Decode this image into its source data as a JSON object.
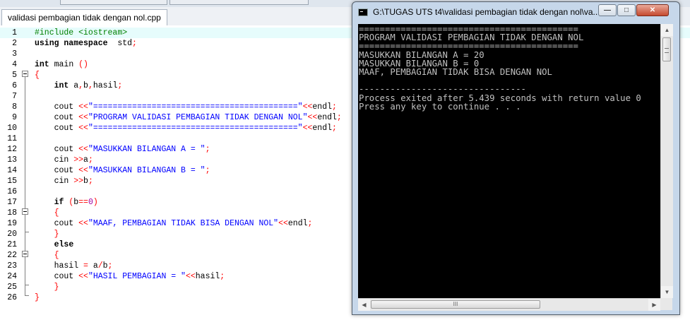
{
  "editor": {
    "tab_label": "validasi pembagian tidak dengan nol.cpp",
    "lines": [
      {
        "n": "1",
        "hl": true,
        "tokens": [
          [
            "pp",
            "#include <iostream>"
          ]
        ]
      },
      {
        "n": "2",
        "tokens": [
          [
            "kw",
            "using namespace"
          ],
          [
            "",
            "  std"
          ],
          [
            "sym",
            ";"
          ]
        ]
      },
      {
        "n": "3",
        "tokens": []
      },
      {
        "n": "4",
        "tokens": [
          [
            "kw",
            "int"
          ],
          [
            "",
            " main "
          ],
          [
            "sym",
            "()"
          ]
        ]
      },
      {
        "n": "5",
        "tokens": [
          [
            "sym",
            "{"
          ]
        ]
      },
      {
        "n": "6",
        "tokens": [
          [
            "",
            "    "
          ],
          [
            "kw",
            "int"
          ],
          [
            "",
            " a"
          ],
          [
            "sym",
            ","
          ],
          [
            "",
            "b"
          ],
          [
            "sym",
            ","
          ],
          [
            "",
            "hasil"
          ],
          [
            "sym",
            ";"
          ]
        ]
      },
      {
        "n": "7",
        "tokens": []
      },
      {
        "n": "8",
        "tokens": [
          [
            "",
            "    cout "
          ],
          [
            "sym",
            "<<"
          ],
          [
            "str",
            "\"==========================================\""
          ],
          [
            "sym",
            "<<"
          ],
          [
            "",
            "endl"
          ],
          [
            "sym",
            ";"
          ]
        ]
      },
      {
        "n": "9",
        "tokens": [
          [
            "",
            "    cout "
          ],
          [
            "sym",
            "<<"
          ],
          [
            "str",
            "\"PROGRAM VALIDASI PEMBAGIAN TIDAK DENGAN NOL\""
          ],
          [
            "sym",
            "<<"
          ],
          [
            "",
            "endl"
          ],
          [
            "sym",
            ";"
          ]
        ]
      },
      {
        "n": "10",
        "tokens": [
          [
            "",
            "    cout "
          ],
          [
            "sym",
            "<<"
          ],
          [
            "str",
            "\"==========================================\""
          ],
          [
            "sym",
            "<<"
          ],
          [
            "",
            "endl"
          ],
          [
            "sym",
            ";"
          ]
        ]
      },
      {
        "n": "11",
        "tokens": []
      },
      {
        "n": "12",
        "tokens": [
          [
            "",
            "    cout "
          ],
          [
            "sym",
            "<<"
          ],
          [
            "str",
            "\"MASUKKAN BILANGAN A = \""
          ],
          [
            "sym",
            ";"
          ]
        ]
      },
      {
        "n": "13",
        "tokens": [
          [
            "",
            "    cin "
          ],
          [
            "sym",
            ">>"
          ],
          [
            "",
            "a"
          ],
          [
            "sym",
            ";"
          ]
        ]
      },
      {
        "n": "14",
        "tokens": [
          [
            "",
            "    cout "
          ],
          [
            "sym",
            "<<"
          ],
          [
            "str",
            "\"MASUKKAN BILANGAN B = \""
          ],
          [
            "sym",
            ";"
          ]
        ]
      },
      {
        "n": "15",
        "tokens": [
          [
            "",
            "    cin "
          ],
          [
            "sym",
            ">>"
          ],
          [
            "",
            "b"
          ],
          [
            "sym",
            ";"
          ]
        ]
      },
      {
        "n": "16",
        "tokens": []
      },
      {
        "n": "17",
        "tokens": [
          [
            "",
            "    "
          ],
          [
            "kw",
            "if"
          ],
          [
            "",
            " "
          ],
          [
            "sym",
            "("
          ],
          [
            "",
            "b"
          ],
          [
            "sym",
            "=="
          ],
          [
            "num",
            "0"
          ],
          [
            "sym",
            ")"
          ]
        ]
      },
      {
        "n": "18",
        "tokens": [
          [
            "",
            "    "
          ],
          [
            "sym",
            "{"
          ]
        ]
      },
      {
        "n": "19",
        "tokens": [
          [
            "",
            "    cout "
          ],
          [
            "sym",
            "<<"
          ],
          [
            "str",
            "\"MAAF, PEMBAGIAN TIDAK BISA DENGAN NOL\""
          ],
          [
            "sym",
            "<<"
          ],
          [
            "",
            "endl"
          ],
          [
            "sym",
            ";"
          ]
        ]
      },
      {
        "n": "20",
        "tokens": [
          [
            "",
            "    "
          ],
          [
            "sym",
            "}"
          ]
        ]
      },
      {
        "n": "21",
        "tokens": [
          [
            "",
            "    "
          ],
          [
            "kw",
            "else"
          ]
        ]
      },
      {
        "n": "22",
        "tokens": [
          [
            "",
            "    "
          ],
          [
            "sym",
            "{"
          ]
        ]
      },
      {
        "n": "23",
        "tokens": [
          [
            "",
            "    hasil "
          ],
          [
            "sym",
            "="
          ],
          [
            "",
            " a"
          ],
          [
            "sym",
            "/"
          ],
          [
            "",
            "b"
          ],
          [
            "sym",
            ";"
          ]
        ]
      },
      {
        "n": "24",
        "tokens": [
          [
            "",
            "    cout "
          ],
          [
            "sym",
            "<<"
          ],
          [
            "str",
            "\"HASIL PEMBAGIAN = \""
          ],
          [
            "sym",
            "<<"
          ],
          [
            "",
            "hasil"
          ],
          [
            "sym",
            ";"
          ]
        ]
      },
      {
        "n": "25",
        "tokens": [
          [
            "",
            "    "
          ],
          [
            "sym",
            "}"
          ]
        ]
      },
      {
        "n": "26",
        "tokens": [
          [
            "sym",
            "}"
          ]
        ]
      }
    ]
  },
  "console_window": {
    "title": "G:\\TUGAS UTS t4\\validasi pembagian tidak dengan nol\\va...",
    "minimize_glyph": "—",
    "maximize_glyph": "□",
    "close_glyph": "✕",
    "scroll_glyph": "III",
    "lines": [
      "==========================================",
      "PROGRAM VALIDASI PEMBAGIAN TIDAK DENGAN NOL",
      "==========================================",
      "MASUKKAN BILANGAN A = 20",
      "MASUKKAN BILANGAN B = 0",
      "MAAF, PEMBAGIAN TIDAK BISA DENGAN NOL",
      "",
      "--------------------------------",
      "Process exited after 5.439 seconds with return value 0",
      "Press any key to continue . . ."
    ]
  }
}
